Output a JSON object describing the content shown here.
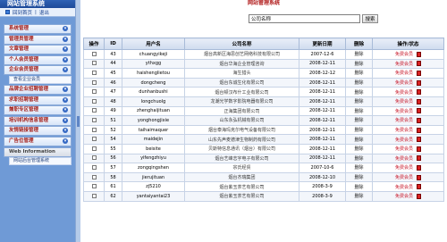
{
  "sidebar": {
    "title": "网站管理系统",
    "links": [
      "回到首页",
      "退出"
    ],
    "menu": [
      {
        "label": "系统管理",
        "arrow": "▾"
      },
      {
        "label": "管理员管理",
        "arrow": "▾"
      },
      {
        "label": "文章管理",
        "arrow": "▾"
      },
      {
        "label": "个人会员管理",
        "arrow": "▾"
      },
      {
        "label": "企业会员管理",
        "arrow": "▾"
      },
      {
        "label": "查看企业会员",
        "arrow": ""
      },
      {
        "label": "品牌企业招聘管理",
        "arrow": "▾"
      },
      {
        "label": "求职招聘管理",
        "arrow": "▾"
      },
      {
        "label": "兼职专区管理",
        "arrow": "▾"
      },
      {
        "label": "培训机构信息管理",
        "arrow": "▾"
      },
      {
        "label": "友情链接管理",
        "arrow": "▾"
      },
      {
        "label": "广告位管理",
        "arrow": "▾"
      },
      {
        "label": "Web Information",
        "arrow": ""
      },
      {
        "label": "网站后台管理系统",
        "arrow": ""
      }
    ]
  },
  "main": {
    "title": "网站管理系统",
    "search": {
      "placeholder": "公司名称",
      "button": "搜索"
    },
    "columns": [
      "操作",
      "ID",
      "用户名",
      "公司名称",
      "更新日期",
      "删除",
      "操作/状态"
    ],
    "rows": [
      {
        "id": "43",
        "user": "chuangyikeji",
        "company": "烟台高新区海思创艺网络科技有限公司",
        "date": "2007-12-6",
        "del": "删除",
        "status": "免费会员"
      },
      {
        "id": "44",
        "user": "ythxgg",
        "company": "烟台华海企业管理咨询",
        "date": "2008-12-11",
        "del": "删除",
        "status": "免费会员"
      },
      {
        "id": "45",
        "user": "haishenglietou",
        "company": "海生猎头",
        "date": "2008-12-12",
        "del": "删除",
        "status": "免费会员"
      },
      {
        "id": "46",
        "user": "dongcheng",
        "company": "烟台东诚生化有限公司",
        "date": "2008-12-11",
        "del": "删除",
        "status": "免费会员"
      },
      {
        "id": "47",
        "user": "dunhanbushi",
        "company": "烟台顿汉布什工业有限公司",
        "date": "2008-12-11",
        "del": "删除",
        "status": "免费会员"
      },
      {
        "id": "48",
        "user": "longchuolg",
        "company": "龙潮光学数字影院电器有限公司",
        "date": "2008-12-11",
        "del": "删除",
        "status": "免费会员"
      },
      {
        "id": "49",
        "user": "zhenghaijituan",
        "company": "正海集团有限公司",
        "date": "2008-12-11",
        "del": "删除",
        "status": "免费会员"
      },
      {
        "id": "51",
        "user": "yonghongjixie",
        "company": "山东永弘机械有限公司",
        "date": "2008-12-11",
        "del": "删除",
        "status": "免费会员"
      },
      {
        "id": "52",
        "user": "taihaimaquer",
        "company": "烟台泰海玛克尔电气设备有限公司",
        "date": "2008-12-11",
        "del": "删除",
        "status": "免费会员"
      },
      {
        "id": "54",
        "user": "maidejin",
        "company": "山东先声麦德津生物制药有限公司",
        "date": "2008-12-11",
        "del": "删除",
        "status": "免费会员"
      },
      {
        "id": "55",
        "user": "beisite",
        "company": "贝斯特信息通讯（烟台）有限公司",
        "date": "2008-12-11",
        "del": "删除",
        "status": "免费会员"
      },
      {
        "id": "56",
        "user": "yifengzhiyu",
        "company": "烟台艺峰志宇电子有限公司",
        "date": "2008-12-11",
        "del": "删除",
        "status": "免费会员"
      },
      {
        "id": "57",
        "user": "zongqingshen",
        "company": "宗氏经贸",
        "date": "2007-10-6",
        "del": "删除",
        "status": "免费会员"
      },
      {
        "id": "58",
        "user": "jierujituan",
        "company": "烟台杰瑞集团",
        "date": "2008-12-10",
        "del": "删除",
        "status": "免费会员"
      },
      {
        "id": "61",
        "user": "zj5210",
        "company": "烟台紫玉茶艺有限公司",
        "date": "2008-3-9",
        "del": "删除",
        "status": "免费会员"
      },
      {
        "id": "62",
        "user": "yantaiyantai23",
        "company": "烟台紫玉茶艺有限公司",
        "date": "2008-3-9",
        "del": "删除",
        "status": "免费会员"
      }
    ]
  },
  "colors": {
    "sidebar_bg": "#6f9ad6",
    "accent_red": "#c8182a",
    "title_red": "#b01a1a"
  },
  "icons": {
    "link": "square-icon",
    "menu_arrow": "chevron-down-circle-icon",
    "edit": "edit-icon"
  }
}
